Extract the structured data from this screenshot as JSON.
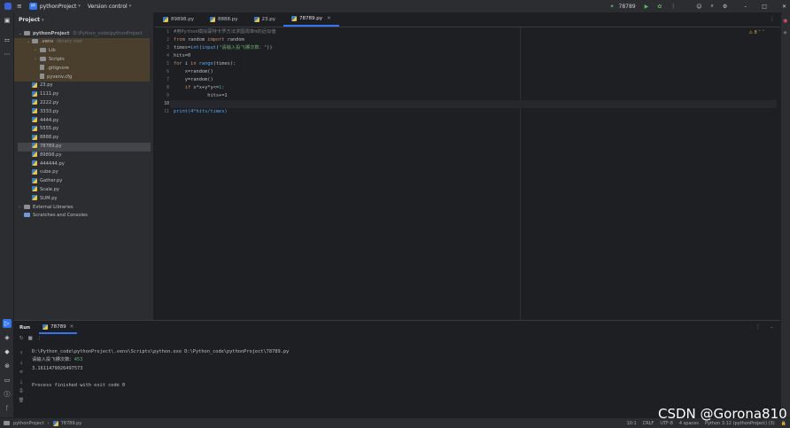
{
  "titlebar": {
    "project_badge": "PP",
    "project_name": "pythonProject",
    "version_control": "Version control",
    "run_config": "78789"
  },
  "project_panel": {
    "title": "Project",
    "tree": [
      {
        "label": "pythonProject",
        "note": "D:\\Python_code\\pythonProject",
        "depth": 0,
        "kind": "folder",
        "expanded": true,
        "bold": true
      },
      {
        "label": ".venv",
        "note": "library root",
        "depth": 1,
        "kind": "folder",
        "expanded": true
      },
      {
        "label": "Lib",
        "depth": 2,
        "kind": "folder",
        "expanded": false
      },
      {
        "label": "Scripts",
        "depth": 2,
        "kind": "folder",
        "expanded": false
      },
      {
        "label": ".gitignore",
        "depth": 2,
        "kind": "file"
      },
      {
        "label": "pyvenv.cfg",
        "depth": 2,
        "kind": "file"
      },
      {
        "label": "23.py",
        "depth": 1,
        "kind": "py"
      },
      {
        "label": "1111.py",
        "depth": 1,
        "kind": "py"
      },
      {
        "label": "2222.py",
        "depth": 1,
        "kind": "py"
      },
      {
        "label": "3333.py",
        "depth": 1,
        "kind": "py"
      },
      {
        "label": "4444.py",
        "depth": 1,
        "kind": "py"
      },
      {
        "label": "5555.py",
        "depth": 1,
        "kind": "py"
      },
      {
        "label": "8888.py",
        "depth": 1,
        "kind": "py"
      },
      {
        "label": "78789.py",
        "depth": 1,
        "kind": "py",
        "selected": true
      },
      {
        "label": "89898.py",
        "depth": 1,
        "kind": "py"
      },
      {
        "label": "444444.py",
        "depth": 1,
        "kind": "py"
      },
      {
        "label": "cube.py",
        "depth": 1,
        "kind": "py"
      },
      {
        "label": "Gather.py",
        "depth": 1,
        "kind": "py"
      },
      {
        "label": "Scale.py",
        "depth": 1,
        "kind": "py"
      },
      {
        "label": "SUM.py",
        "depth": 1,
        "kind": "py"
      },
      {
        "label": "External Libraries",
        "depth": 0,
        "kind": "lib",
        "expanded": false
      },
      {
        "label": "Scratches and Consoles",
        "depth": 0,
        "kind": "scratch"
      }
    ]
  },
  "editor": {
    "tabs": [
      {
        "label": "89898.py",
        "active": false
      },
      {
        "label": "8888.py",
        "active": false
      },
      {
        "label": "23.py",
        "active": false
      },
      {
        "label": "78789.py",
        "active": true
      }
    ],
    "warning_count": "8",
    "line_numbers": [
      "1",
      "2",
      "3",
      "4",
      "5",
      "6",
      "7",
      "8",
      "9",
      "10",
      "11"
    ],
    "line_9_code": "            hits+=1",
    "line_10_code": "",
    "line_11_code": "print(4*hits/times)"
  },
  "code": {
    "l1": "#用Python模拟蒙特卡罗方法求圆周率π的近似值",
    "l2_kw1": "from",
    "l2_mod": " random ",
    "l2_kw2": "import",
    "l2_name": " random",
    "l3_a": "times=",
    "l3_fn1": "int",
    "l3_b": "(",
    "l3_fn2": "input",
    "l3_c": "(",
    "l3_str": "\"请输入投飞镖次数：\"",
    "l3_d": "))",
    "l4": "hits=0",
    "l5_kw": "for",
    "l5_a": " i ",
    "l5_kw2": "in",
    "l5_fn": " range",
    "l5_b": "(times):",
    "l6": "    x=random()",
    "l7": "    y=random()",
    "l8_kw": "    if",
    "l8_a": " x*x+y*y<=",
    "l8_num": "1",
    "l8_b": ":"
  },
  "run": {
    "title": "Run",
    "tab_label": "78789",
    "console": [
      "D:\\Python_code\\pythonProject\\.venv\\Scripts\\python.exe D:\\Python_code\\pythonProject\\78789.py",
      "请输入投飞镖次数：",
      "3.1611479026497573",
      "",
      "Process finished with exit code 0"
    ],
    "input_value": "453"
  },
  "statusbar": {
    "crumb_project": "pythonProject",
    "crumb_file": "78789.py",
    "position": "10:1",
    "line_sep": "CRLF",
    "encoding": "UTF-8",
    "indent": "4 spaces",
    "interpreter": "Python 3.12 (pythonProject) (3)"
  },
  "watermark": "CSDN @Gorona810"
}
